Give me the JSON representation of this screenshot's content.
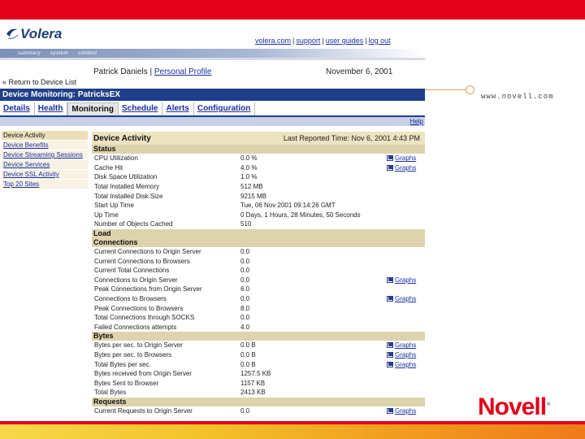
{
  "slide": {
    "url": "www.novell.com",
    "logo": "Novell",
    "logo_mark": "®"
  },
  "app": {
    "logo": "Volera",
    "top_links": [
      "volera.com",
      "support",
      "user guides",
      "log out"
    ],
    "nav": [
      "summary",
      "system",
      "content"
    ],
    "user": "Patrick Daniels",
    "profile_link": "Personal Profile",
    "date": "November 6, 2001",
    "return_link": "« Return to Device List",
    "page_title": "Device Monitoring: PatricksEX",
    "tabs": [
      {
        "label": "Details"
      },
      {
        "label": "Health"
      },
      {
        "label": "Monitoring"
      },
      {
        "label": "Schedule"
      },
      {
        "label": "Alerts"
      },
      {
        "label": "Configuration"
      }
    ],
    "help": "Help",
    "sidemenu": [
      "Device Activity",
      "Device Benefits",
      "Device Streaming Sessions",
      "Device Services",
      "Device SSL Activity",
      "Top 20 Sites"
    ],
    "table_title": "Device Activity",
    "last_reported": "Last Reported Time: Nov 6, 2001 4:43 PM",
    "graph_label": "Graphs"
  },
  "sections": [
    {
      "title": "Status",
      "rows": [
        {
          "label": "CPU Utilization",
          "value": "0.0 %",
          "graph": true
        },
        {
          "label": "Cache Hit",
          "value": "4.0 %",
          "graph": true
        },
        {
          "label": "Disk Space Utilization",
          "value": "1.0 %",
          "graph": false
        },
        {
          "label": "Total Installed Memory",
          "value": "512 MB",
          "graph": false
        },
        {
          "label": "Total Installed Disk Size",
          "value": "9215 MB",
          "graph": false
        },
        {
          "label": "Start Up Time",
          "value": "Tue, 06 Nov 2001 09:14:26 GMT",
          "graph": false
        },
        {
          "label": "Up Time",
          "value": "0 Days, 1 Hours, 28 Minutes, 50 Seconds",
          "graph": false
        },
        {
          "label": "Number of Objects Cached",
          "value": "510",
          "graph": false
        }
      ]
    },
    {
      "title": "Load",
      "rows": []
    },
    {
      "title": "Connections",
      "rows": [
        {
          "label": "Current Connections to Origin Server",
          "value": "0.0",
          "graph": false
        },
        {
          "label": "Current Connections to Browsers",
          "value": "0.0",
          "graph": false
        },
        {
          "label": "Current Total Connections",
          "value": "0.0",
          "graph": false
        },
        {
          "label": "Connections to Origin Server",
          "value": "0.0",
          "graph": true
        },
        {
          "label": "Peak Connections from Origin Server",
          "value": "6.0",
          "graph": false
        },
        {
          "label": "Connections to Browsers",
          "value": "0.0",
          "graph": true
        },
        {
          "label": "Peak Connections to Browsers",
          "value": "8.0",
          "graph": false
        },
        {
          "label": "Total Connections through SOCKS",
          "value": "0.0",
          "graph": false
        },
        {
          "label": "Failed Connections attempts",
          "value": "4.0",
          "graph": false
        }
      ]
    },
    {
      "title": "Bytes",
      "rows": [
        {
          "label": "Bytes per sec. to Origin Server",
          "value": "0.0 B",
          "graph": true
        },
        {
          "label": "Bytes per sec. to Browsers",
          "value": "0.0 B",
          "graph": true
        },
        {
          "label": "Total Bytes per sec.",
          "value": "0.0 B",
          "graph": true
        },
        {
          "label": "Bytes received from Origin Server",
          "value": "1257.5 KB",
          "graph": false
        },
        {
          "label": "Bytes Sent to Browser",
          "value": "1157 KB",
          "graph": false
        },
        {
          "label": "Total Bytes",
          "value": "2413 KB",
          "graph": false
        }
      ]
    },
    {
      "title": "Requests",
      "rows": [
        {
          "label": "Current Requests to Origin Server",
          "value": "0.0",
          "graph": true
        }
      ]
    }
  ]
}
